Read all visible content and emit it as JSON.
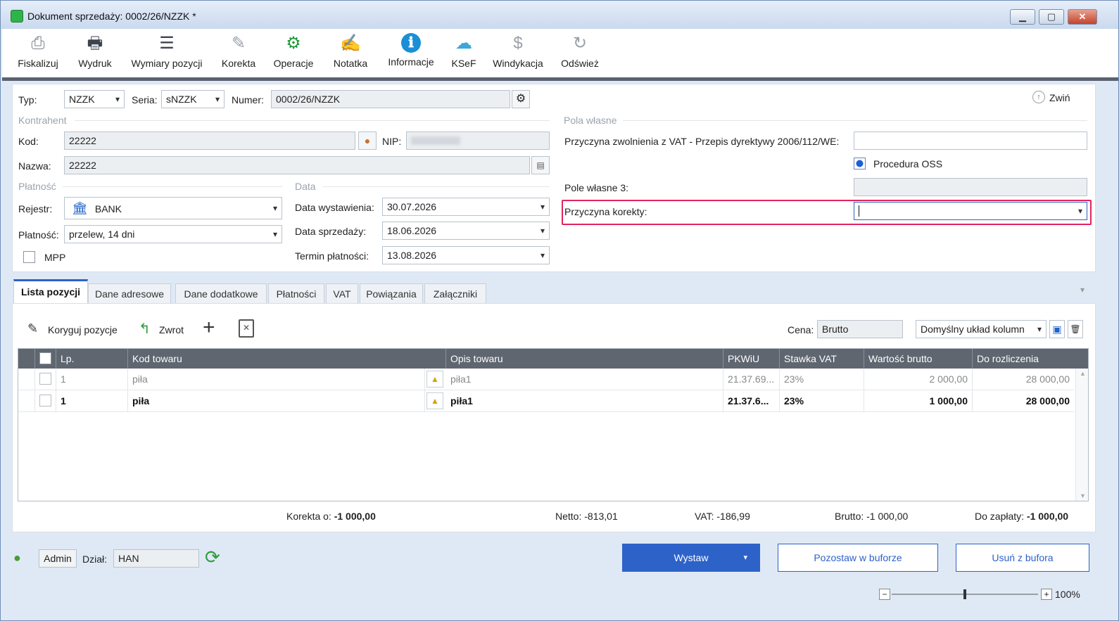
{
  "window": {
    "title": "Dokument sprzedaży: 0002/26/NZZK *",
    "btn_min": "▁",
    "btn_max": "▢",
    "btn_close": "✕"
  },
  "toolbar": [
    {
      "label": "Fiskalizuj",
      "icon": "⎙"
    },
    {
      "label": "Wydruk",
      "icon": "🖶"
    },
    {
      "label": "Wymiary pozycji",
      "icon": "☰"
    },
    {
      "label": "Korekta",
      "icon": "✎"
    },
    {
      "label": "Operacje",
      "icon": "⚙"
    },
    {
      "label": "Notatka",
      "icon": "✍"
    },
    {
      "label": "Informacje",
      "icon": "ℹ"
    },
    {
      "label": "KSeF",
      "icon": "☁"
    },
    {
      "label": "Windykacja",
      "icon": "$"
    },
    {
      "label": "Odśwież",
      "icon": "↻"
    }
  ],
  "header": {
    "typ_label": "Typ:",
    "typ_value": "NZZK",
    "seria_label": "Seria:",
    "seria_value": "sNZZK",
    "numer_label": "Numer:",
    "numer_value": "0002/26/NZZK",
    "collapse_label": "Zwiń"
  },
  "kontrahent": {
    "section": "Kontrahent",
    "kod_label": "Kod:",
    "kod_value": "22222",
    "nip_label": "NIP:",
    "nazwa_label": "Nazwa:",
    "nazwa_value": "22222"
  },
  "platnosc": {
    "section": "Płatność",
    "rejestr_label": "Rejestr:",
    "rejestr_value": "BANK",
    "platnosc_label": "Płatność:",
    "platnosc_value": "przelew, 14 dni",
    "mpp_label": "MPP"
  },
  "data": {
    "section": "Data",
    "wyst_label": "Data wystawienia:",
    "wyst_value": "30.07.2026",
    "sprz_label": "Data sprzedaży:",
    "sprz_value": "18.06.2026",
    "termin_label": "Termin płatności:",
    "termin_value": "13.08.2026"
  },
  "pola": {
    "section": "Pola własne",
    "vat_label": "Przyczyna zwolnienia z VAT - Przepis dyrektywy 2006/112/WE:",
    "oss_label": "Procedura OSS",
    "pole3_label": "Pole własne 3:",
    "korekta_label": "Przyczyna korekty:"
  },
  "tabs": [
    "Lista pozycji",
    "Dane adresowe",
    "Dane dodatkowe",
    "Płatności",
    "VAT",
    "Powiązania",
    "Załączniki"
  ],
  "list_toolbar": {
    "koryguj": "Koryguj pozycje",
    "zwrot": "Zwrot",
    "cena_label": "Cena:",
    "cena_value": "Brutto",
    "uklad": "Domyślny układ kolumn"
  },
  "grid": {
    "columns": [
      "Lp.",
      "Kod towaru",
      "Opis towaru",
      "PKWiU",
      "Stawka VAT",
      "Wartość brutto",
      "Do rozliczenia"
    ],
    "rows": [
      {
        "lp": "1",
        "kod": "piła",
        "opis": "piła1",
        "pkwiu": "21.37.69...",
        "vat": "23%",
        "brutto": "2 000,00",
        "rozl": "28 000,00"
      },
      {
        "lp": "1",
        "kod": "piła",
        "opis": "piła1",
        "pkwiu": "21.37.6...",
        "vat": "23%",
        "brutto": "1 000,00",
        "rozl": "28 000,00"
      }
    ]
  },
  "totals": {
    "korekta_label": "Korekta o:",
    "korekta_value": "-1 000,00",
    "netto_label": "Netto:",
    "netto_value": "-813,01",
    "vat_label": "VAT:",
    "vat_value": "-186,99",
    "brutto_label": "Brutto:",
    "brutto_value": "-1 000,00",
    "dozaplaty_label": "Do zapłaty:",
    "dozaplaty_value": "-1 000,00"
  },
  "footer": {
    "user": "Admin",
    "dzial_label": "Dział:",
    "dzial_value": "HAN",
    "wystaw": "Wystaw",
    "pozostaw": "Pozostaw w buforze",
    "usun": "Usuń z bufora",
    "zoom": "100%",
    "zoom_level": 0.5
  }
}
